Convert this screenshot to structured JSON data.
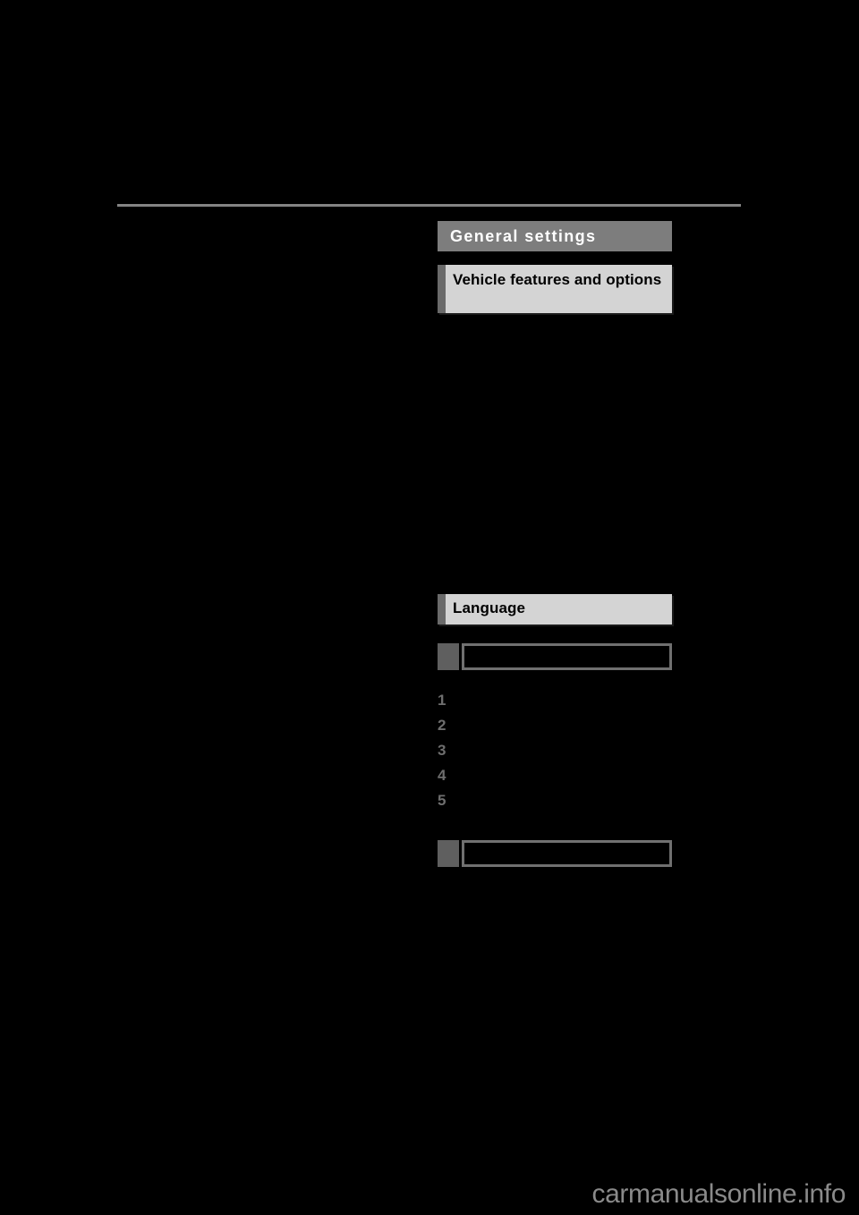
{
  "page": {
    "background_color": "#000000",
    "redacted": true
  },
  "rule": {
    "color": "#848484"
  },
  "chapter": {
    "title": "General settings",
    "bar_color": "#7d7d7d",
    "text_color": "#ffffff"
  },
  "sections": [
    {
      "id": "vehicle-features-and-options",
      "title": "Vehicle features and options",
      "tab_color": "#6a6a6a",
      "body_color": "#d4d4d4"
    },
    {
      "id": "language",
      "title": "Language",
      "tab_color": "#6a6a6a",
      "body_color": "#d4d4d4"
    }
  ],
  "step_boxes": [
    {
      "id": "step-box-1",
      "marker_color": "#5f5f5f",
      "border_color": "#707070",
      "text": ""
    },
    {
      "id": "step-box-2",
      "marker_color": "#5f5f5f",
      "border_color": "#707070",
      "text": ""
    }
  ],
  "numbered_list": {
    "items": [
      {
        "num": "1",
        "text": ""
      },
      {
        "num": "2",
        "text": ""
      },
      {
        "num": "3",
        "text": ""
      },
      {
        "num": "4",
        "text": ""
      },
      {
        "num": "5",
        "text": ""
      }
    ],
    "number_color": "#6e6e6e"
  },
  "watermark": {
    "name": "carmanualsonline",
    "tld": ".info",
    "color": "#8a8a8a"
  }
}
